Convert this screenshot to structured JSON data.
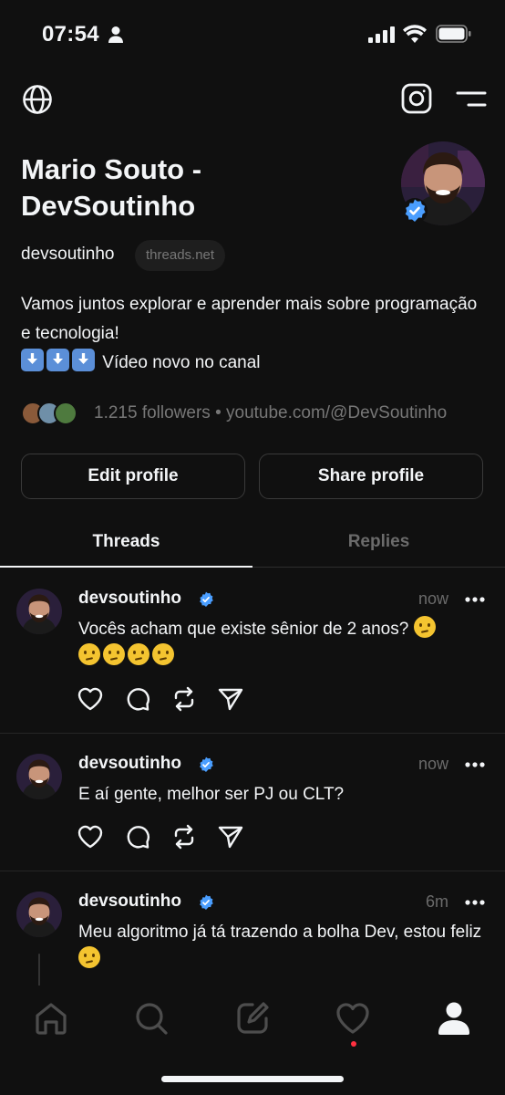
{
  "status_bar": {
    "time": "07:54"
  },
  "profile": {
    "name": "Mario Souto - DevSoutinho",
    "handle": "devsoutinho",
    "domain": "threads.net",
    "bio_line1": "Vamos juntos explorar e aprender mais sobre programação e tecnologia!",
    "bio_line2": "Vídeo novo no canal",
    "followers_text": "1.215 followers",
    "link_text": "youtube.com/@DevSoutinho",
    "edit_button": "Edit profile",
    "share_button": "Share profile"
  },
  "tabs": [
    {
      "label": "Threads",
      "active": true
    },
    {
      "label": "Replies",
      "active": false
    }
  ],
  "posts": [
    {
      "username": "devsoutinho",
      "time": "now",
      "text": "Vocês acham que existe sênior de 2 anos?"
    },
    {
      "username": "devsoutinho",
      "time": "now",
      "text": "E aí gente, melhor ser PJ ou CLT?"
    },
    {
      "username": "devsoutinho",
      "time": "6m",
      "text": "Meu algoritmo já tá trazendo a bolha Dev, estou feliz"
    }
  ],
  "colors": {
    "background": "#101010",
    "text": "#f3f5f7",
    "muted": "#777777",
    "verified": "#4a9eff",
    "notification_dot": "#ff3040"
  },
  "icons": {
    "top": [
      "globe-icon",
      "instagram-icon",
      "menu-icon"
    ],
    "post_actions": [
      "heart-icon",
      "comment-icon",
      "repost-icon",
      "send-icon"
    ],
    "bottom_nav": [
      "home-icon",
      "search-icon",
      "compose-icon",
      "activity-icon",
      "profile-icon"
    ]
  }
}
